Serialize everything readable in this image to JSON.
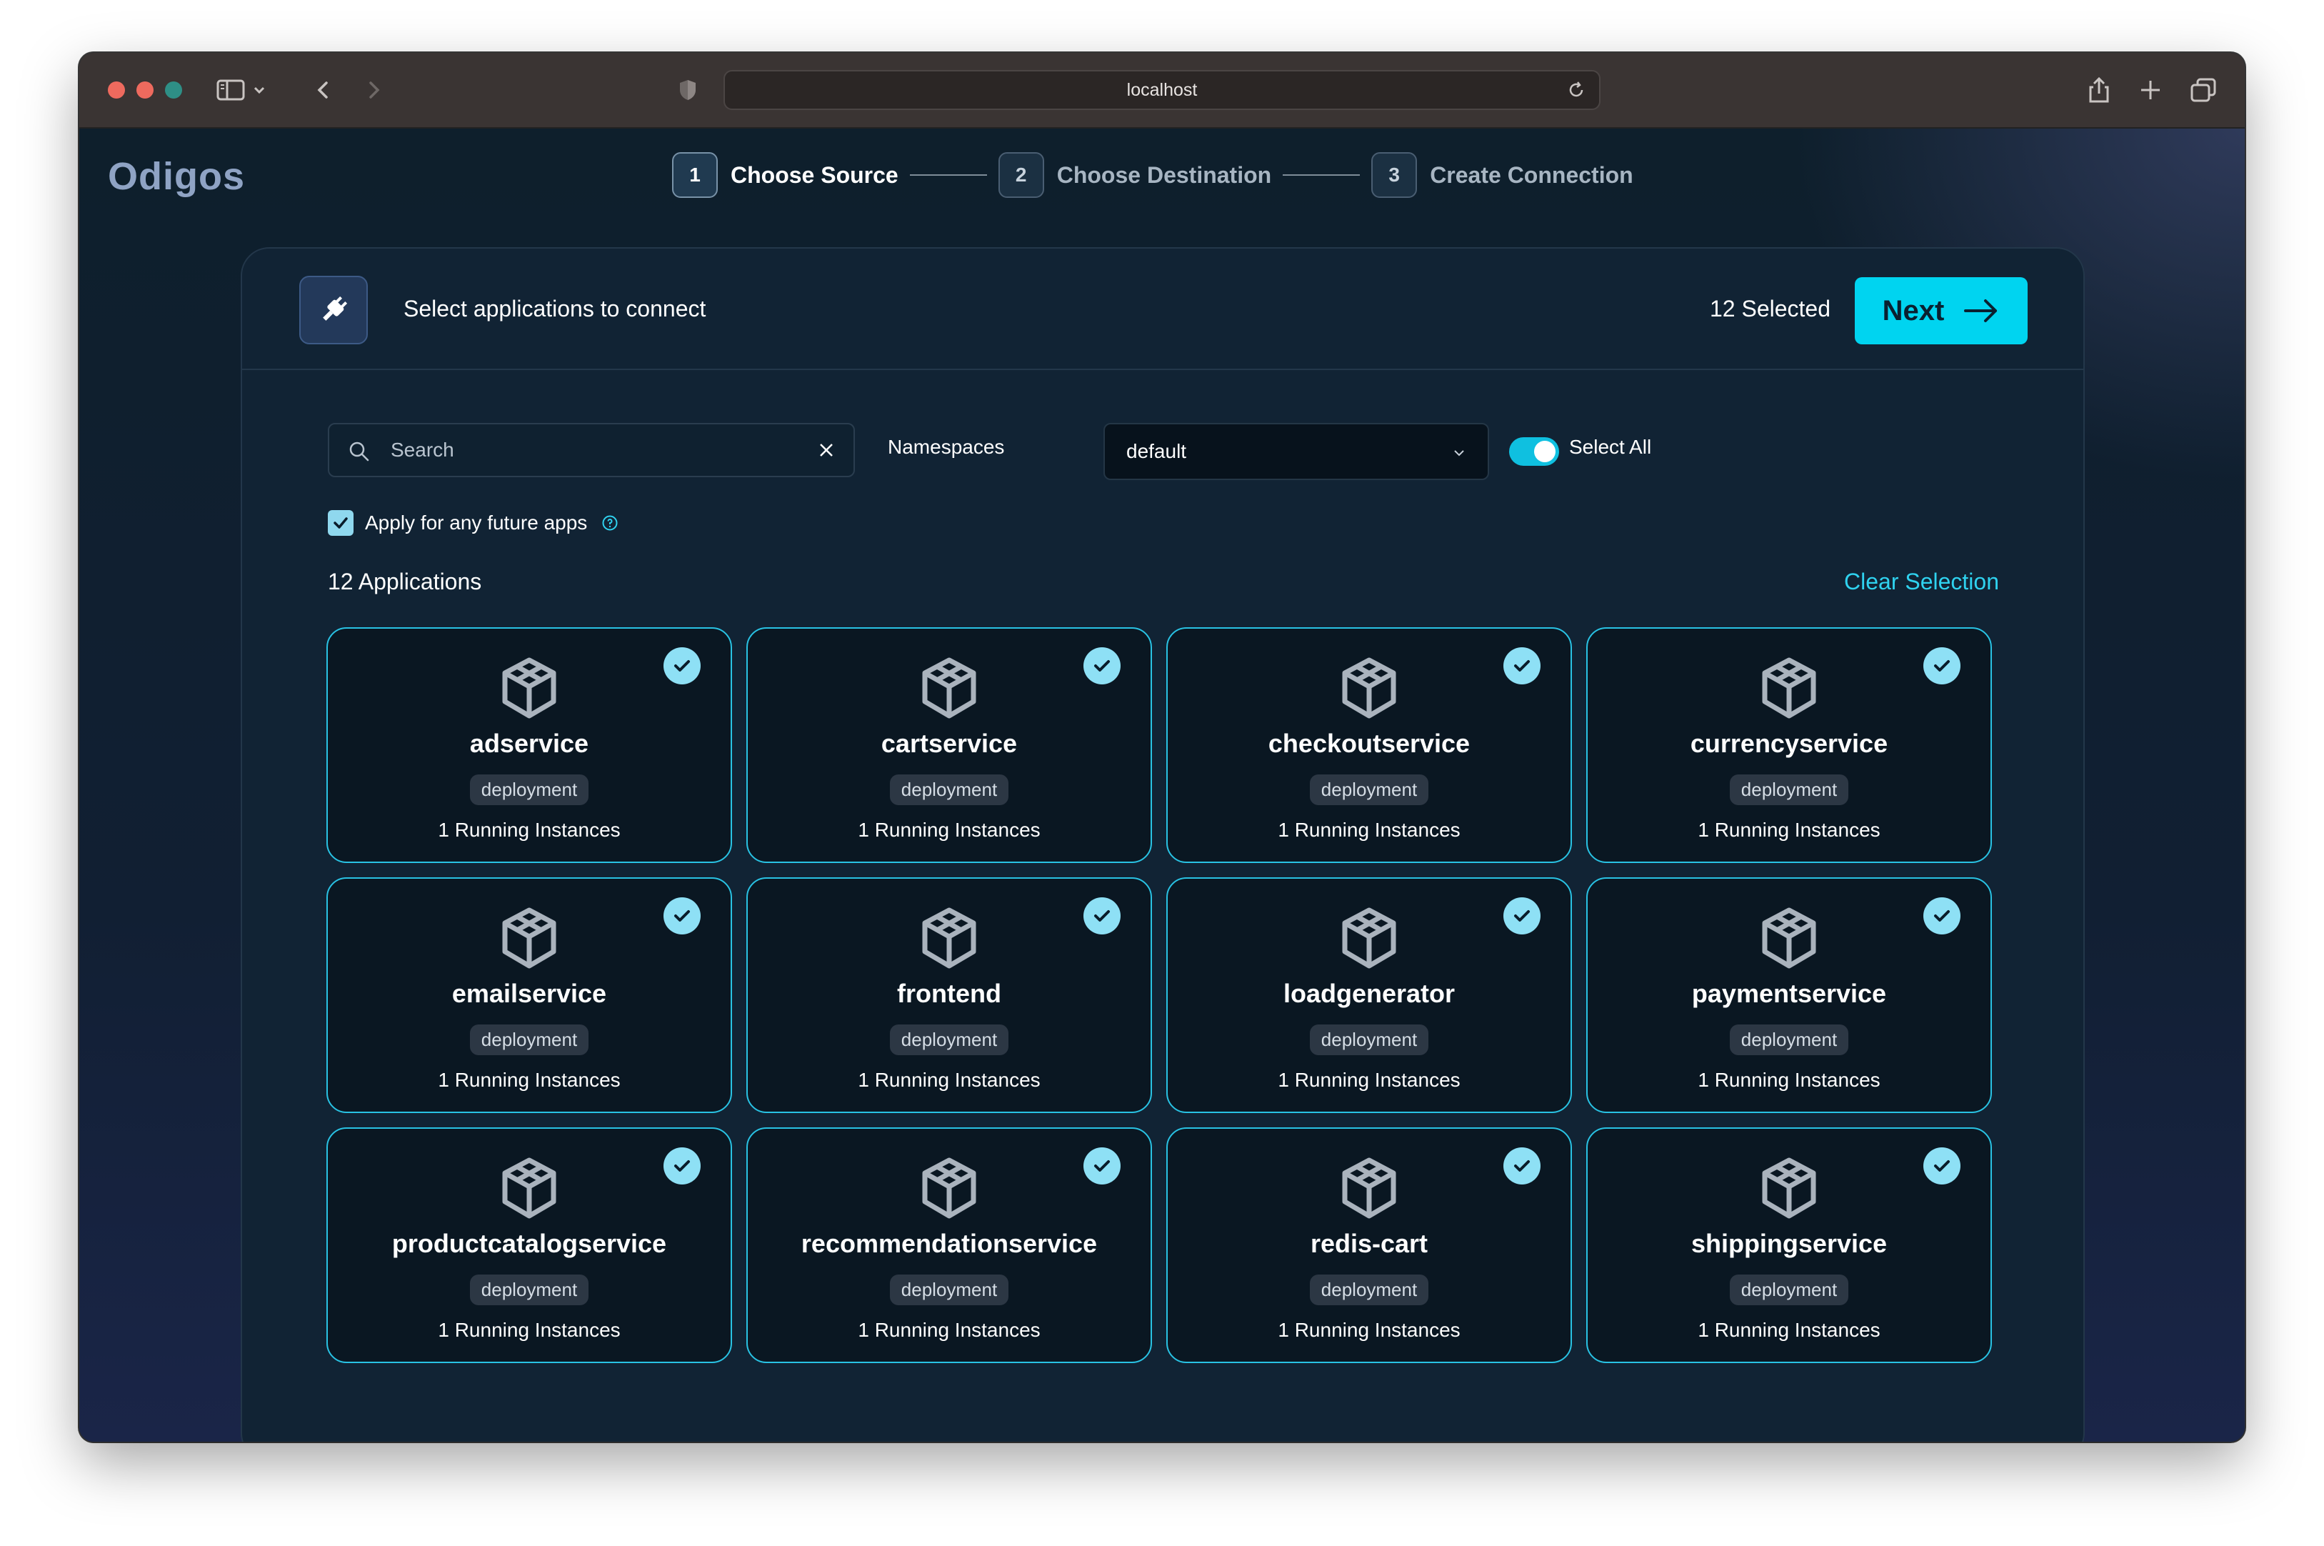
{
  "browser": {
    "address": "localhost",
    "icons": [
      "sidebar-icon",
      "chevron-down-icon",
      "back-icon",
      "forward-icon",
      "shield-icon",
      "reload-icon",
      "share-icon",
      "new-tab-icon",
      "tabs-overview-icon"
    ]
  },
  "brand": "Odigos",
  "steps": [
    {
      "num": "1",
      "label": "Choose Source",
      "active": true
    },
    {
      "num": "2",
      "label": "Choose Destination",
      "active": false
    },
    {
      "num": "3",
      "label": "Create Connection",
      "active": false
    }
  ],
  "header": {
    "icon": "plug-icon",
    "title": "Select applications to connect",
    "selected": "12  Selected",
    "next_label": "Next"
  },
  "filters": {
    "search_placeholder": "Search",
    "namespaces_label": "Namespaces",
    "namespace_value": "default",
    "select_all_label": "Select All",
    "select_all_on": true,
    "future_apps_label": "Apply for any future apps",
    "future_apps_checked": true
  },
  "summary": {
    "count_label": "12 Applications",
    "clear_label": "Clear Selection"
  },
  "colors": {
    "accent": "#00d4f0",
    "card_border": "#29c2e3",
    "background": "#0c1b27"
  },
  "apps": [
    {
      "name": "adservice",
      "kind": "deployment",
      "instances": "1 Running Instances"
    },
    {
      "name": "cartservice",
      "kind": "deployment",
      "instances": "1 Running Instances"
    },
    {
      "name": "checkoutservice",
      "kind": "deployment",
      "instances": "1 Running Instances"
    },
    {
      "name": "currencyservice",
      "kind": "deployment",
      "instances": "1 Running Instances"
    },
    {
      "name": "emailservice",
      "kind": "deployment",
      "instances": "1 Running Instances"
    },
    {
      "name": "frontend",
      "kind": "deployment",
      "instances": "1 Running Instances"
    },
    {
      "name": "loadgenerator",
      "kind": "deployment",
      "instances": "1 Running Instances"
    },
    {
      "name": "paymentservice",
      "kind": "deployment",
      "instances": "1 Running Instances"
    },
    {
      "name": "productcatalogservice",
      "kind": "deployment",
      "instances": "1 Running Instances"
    },
    {
      "name": "recommendationservice",
      "kind": "deployment",
      "instances": "1 Running Instances"
    },
    {
      "name": "redis-cart",
      "kind": "deployment",
      "instances": "1 Running Instances"
    },
    {
      "name": "shippingservice",
      "kind": "deployment",
      "instances": "1 Running Instances"
    }
  ]
}
